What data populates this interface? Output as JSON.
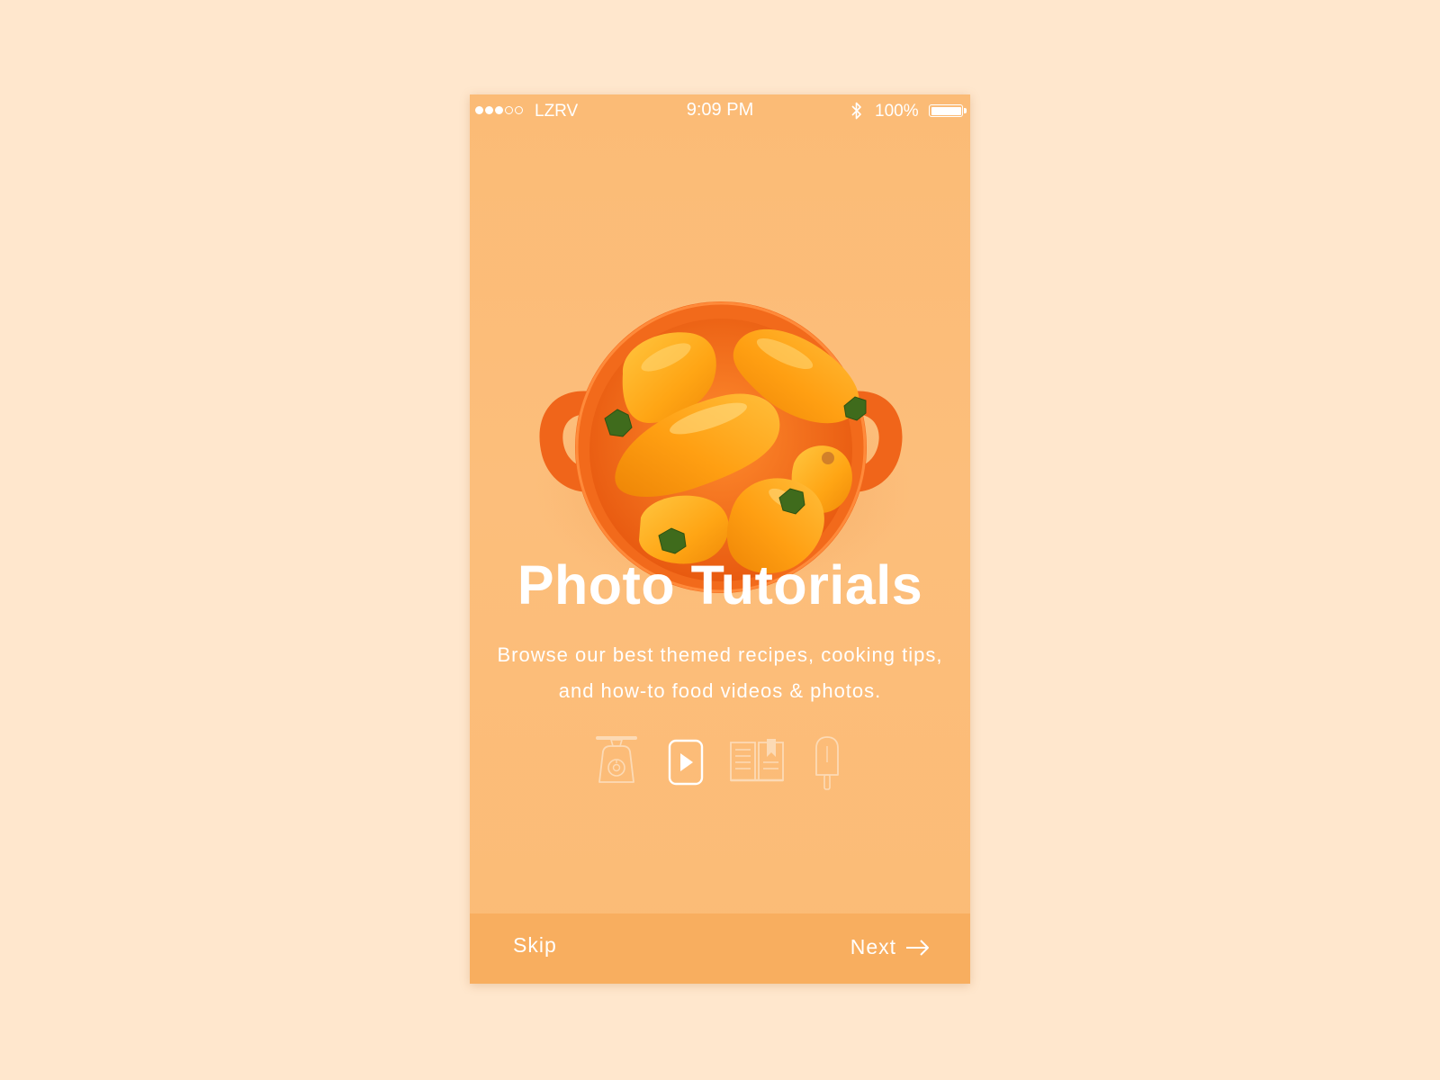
{
  "status_bar": {
    "carrier": "LZRV",
    "time": "9:09 PM",
    "battery": "100%",
    "signal_bars": 3,
    "signal_total": 5
  },
  "hero": {
    "icon": "bowl-of-orange-peppers-photo"
  },
  "onboarding": {
    "title": "Photo Tutorials",
    "description": "Browse our best themed recipes, cooking tips, and how-to food videos & photos."
  },
  "feature_icons": [
    {
      "icon": "kitchen-scale-icon",
      "active": false
    },
    {
      "icon": "play-video-icon",
      "active": true
    },
    {
      "icon": "recipe-book-icon",
      "active": false
    },
    {
      "icon": "popsicle-icon",
      "active": false
    }
  ],
  "navigation": {
    "skip_label": "Skip",
    "next_label": "Next",
    "next_icon": "arrow-right-icon"
  },
  "colors": {
    "page_background": "#ffe7cd",
    "screen_background": "#fbbb76",
    "bottom_bar": "#f8ae5f",
    "bowl": "#f26a1b",
    "pepper": "#ffac1c",
    "text": "#ffffff"
  }
}
